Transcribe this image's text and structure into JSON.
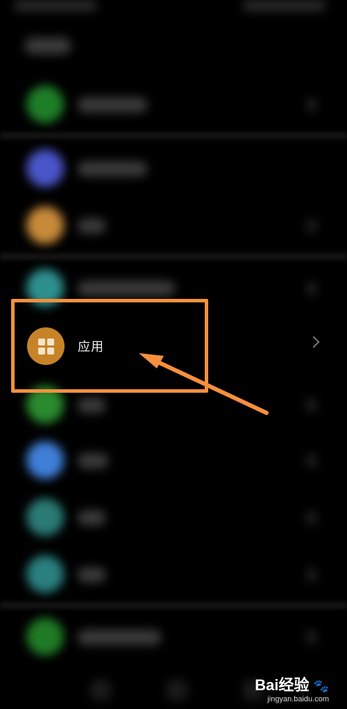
{
  "settings_list": {
    "apps_item": {
      "label": "应用",
      "icon": "apps-grid-icon",
      "accent": "#c78328"
    }
  },
  "annotation": {
    "highlight_color": "#f7903d"
  },
  "watermark": {
    "brand": "Bai经验",
    "paw": "🐾",
    "url": "jingyan.baidu.com"
  }
}
